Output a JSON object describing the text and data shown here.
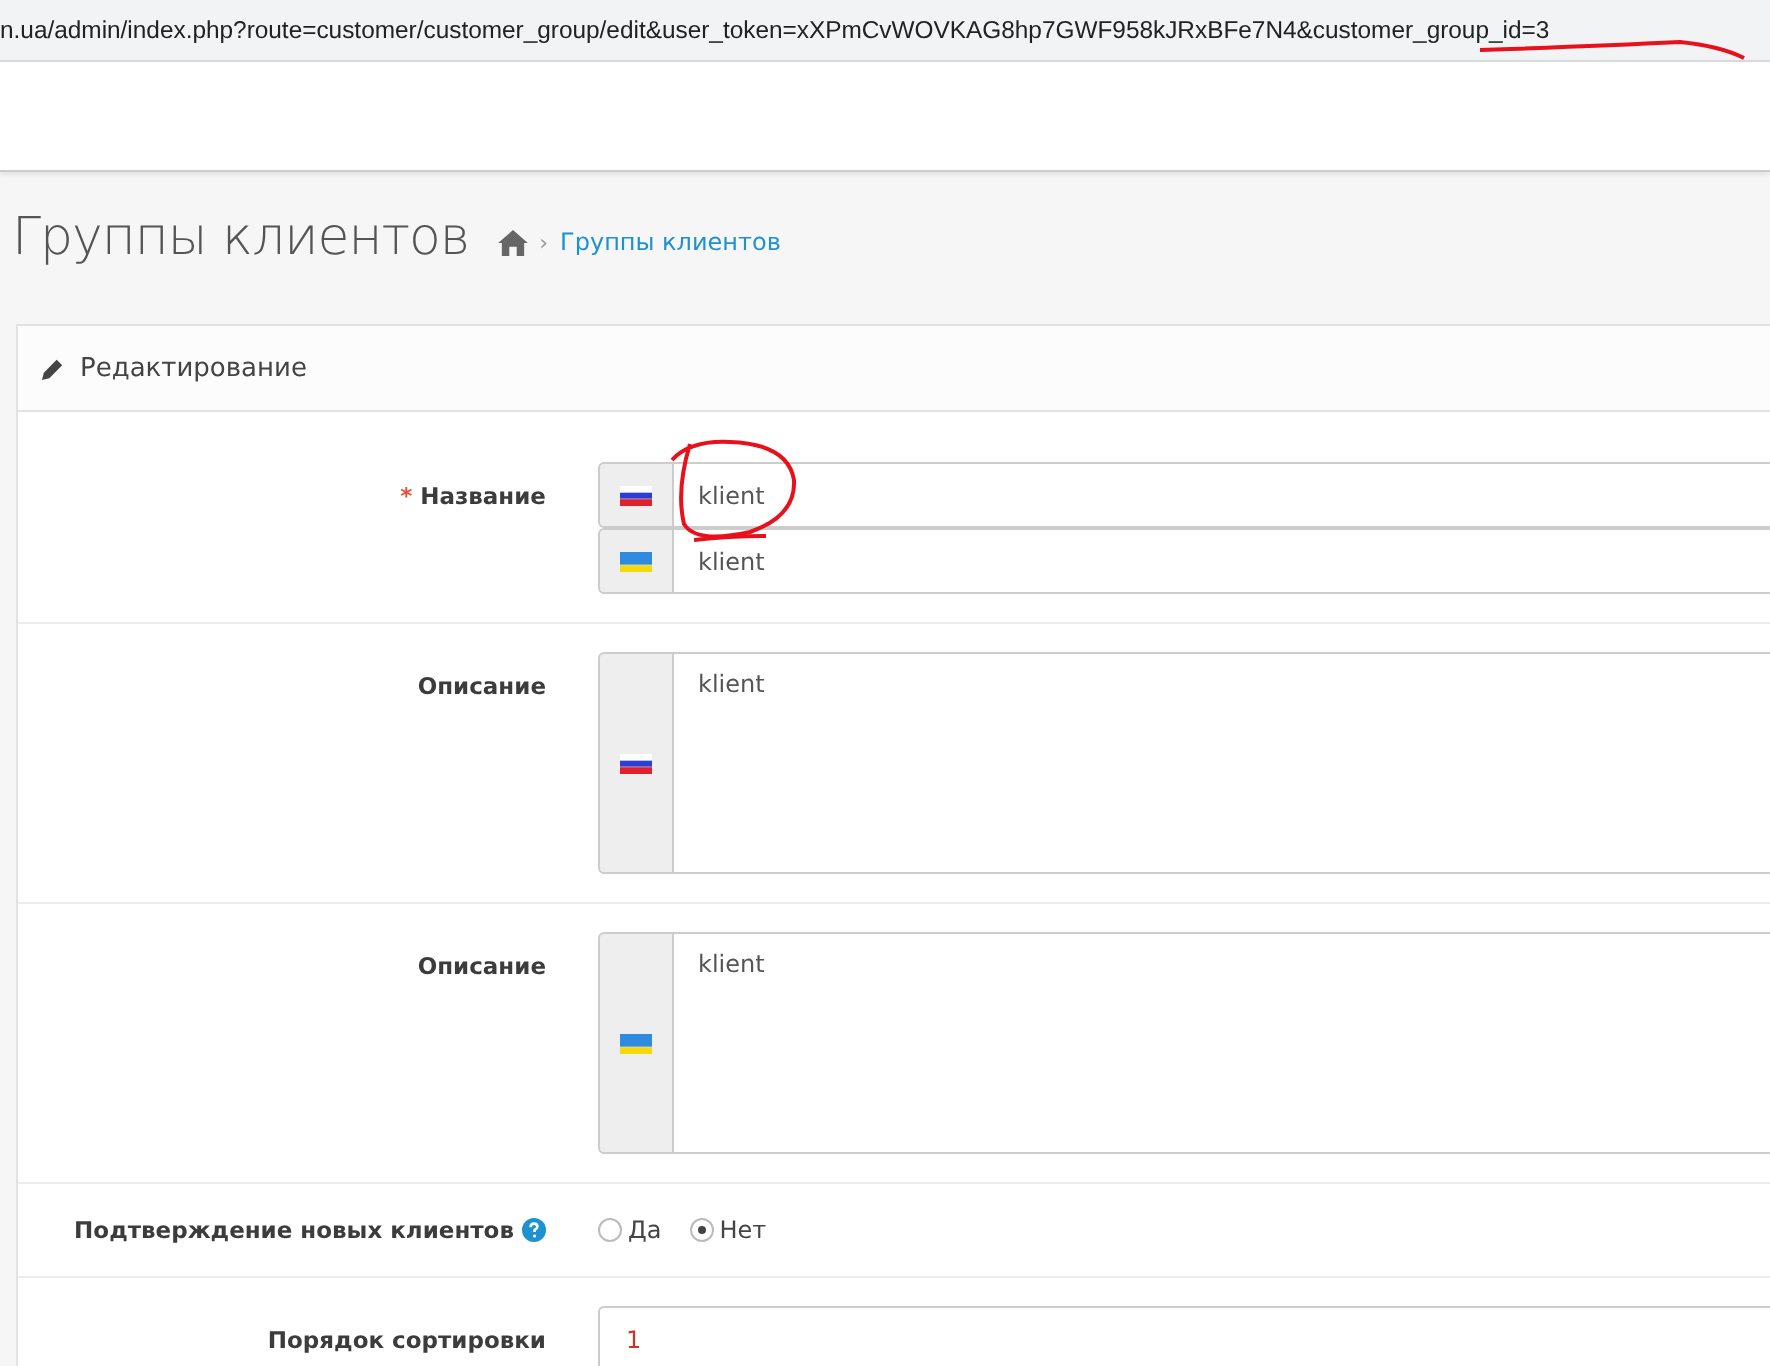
{
  "address_bar": {
    "url": "n.ua/admin/index.php?route=customer/customer_group/edit&user_token=xXPmCvWOVKAG8hp7GWF958kJRxBFe7N4&customer_group_id=3"
  },
  "page_title": "Группы клиентов",
  "breadcrumb": [
    {
      "separator": "›",
      "label": "Группы клиентов"
    }
  ],
  "panel": {
    "title": "Редактирование",
    "fields": [
      {
        "kind": "input",
        "label": "Название",
        "required_mark": "*",
        "entries": [
          {
            "kind": "russian",
            "value": "klient"
          },
          {
            "kind": "ukrainian",
            "value": "klient"
          }
        ]
      },
      {
        "kind": "textarea",
        "label": "Описание",
        "entries": [
          {
            "kind": "russian",
            "value": "klient"
          }
        ]
      },
      {
        "kind": "textarea",
        "label": "Описание",
        "entries": [
          {
            "kind": "ukrainian",
            "value": "klient"
          }
        ]
      },
      {
        "kind": "radio",
        "label": "Подтверждение новых клиентов",
        "help": true,
        "options": [
          {
            "label": "Да",
            "selected": false
          },
          {
            "label": "Нет",
            "selected": true
          }
        ]
      },
      {
        "kind": "plain_input",
        "label": "Порядок сортировки",
        "value": "1"
      }
    ]
  }
}
